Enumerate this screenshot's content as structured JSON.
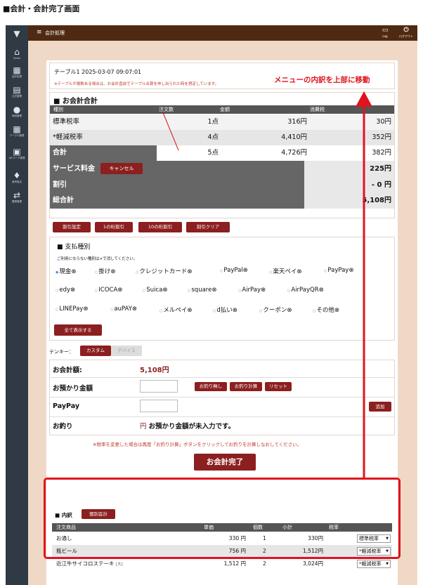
{
  "doc_title": "■会計・会計完了画面",
  "sidebar": {
    "items": [
      {
        "icon": "filter-icon",
        "glyph": "▼",
        "label": ""
      },
      {
        "icon": "home-icon",
        "glyph": "⌂",
        "label": "Home"
      },
      {
        "icon": "calculator-icon",
        "glyph": "▦",
        "label": "会計処理"
      },
      {
        "icon": "document-icon",
        "glyph": "▤",
        "label": "注文管理"
      },
      {
        "icon": "user-icon",
        "glyph": "●",
        "label": "商品管理"
      },
      {
        "icon": "table-icon",
        "glyph": "▦",
        "label": "テーブル管理"
      },
      {
        "icon": "qr-icon",
        "glyph": "▣",
        "label": "QRコード管理"
      },
      {
        "icon": "mic-icon",
        "glyph": "♦",
        "label": "音声設定"
      },
      {
        "icon": "transfer-icon",
        "glyph": "⇄",
        "label": "履歴管理"
      }
    ]
  },
  "topbar": {
    "menu_glyph": "≡",
    "title": "会計処理",
    "log_label": "Log",
    "logout_label": "ログアウト"
  },
  "header": {
    "datetime": "テーブル1 2025-03-07 09:07:01",
    "note": "※テーブルが複数ある場合は、お会計直前でテーブル合算を申し出られた時を想定しています。"
  },
  "summary": {
    "title": "■ お会計合計",
    "columns": [
      "種別",
      "注文数",
      "金額",
      "消費税"
    ],
    "rows": [
      {
        "label": "標準税率",
        "count": "1点",
        "amount": "316円",
        "tax": "30円"
      },
      {
        "label": "*軽減税率",
        "count": "4点",
        "amount": "4,410円",
        "tax": "352円"
      },
      {
        "label": "合計",
        "count": "5点",
        "amount": "4,726円",
        "tax": "382円"
      }
    ],
    "service_label": "サービス料金",
    "cancel_label": "キャンセル",
    "service_value": "225円",
    "discount_label": "割引",
    "discount_value": "- 0 円",
    "total_label": "総合計",
    "total_value": "5,108円"
  },
  "discount_buttons": [
    "割引設定",
    "1の桁割引",
    "10の桁割引",
    "割引クリア"
  ],
  "payment": {
    "title": "■ 支払種別",
    "note": "ご利用にならない種別は×で消してください。",
    "items": [
      "現金⊗",
      "掛け⊗",
      "クレジットカード⊗",
      "PayPal⊗",
      "楽天ペイ⊗",
      "PayPay⊗",
      "edy⊗",
      "ICOCA⊗",
      "Suica⊗",
      "square⊗",
      "AirPay⊗",
      "AirPayQR⊗",
      "LINEPay⊗",
      "auPAY⊗",
      "メルペイ⊗",
      "d払い⊗",
      "クーポン⊗",
      "その他⊗"
    ],
    "show_all": "全て表示する"
  },
  "tenkey": {
    "label": "テンキー：",
    "custom": "カスタム",
    "device": "デバイス"
  },
  "checkout": {
    "total_label": "お会計額:",
    "total_value": "5,108円",
    "deposit_label": "お預かり金額",
    "btn_no_change": "お釣り無し",
    "btn_calc": "お釣り計算",
    "btn_reset": "リセット",
    "paypay_label": "PayPay",
    "add_label": "追加",
    "change_label": "お釣り",
    "change_unit": "円",
    "change_msg": "お預かり金額が未入力です。",
    "warning": "※税率を変更した場合は再度「お釣り計算」ボタンをクリックしてお釣りを計算しなおしてください。",
    "complete": "お会計完了"
  },
  "annotation": "メニューの内訳を上部に移動",
  "breakdown": {
    "title": "■ 内訳",
    "tab": "個別会計",
    "columns": [
      "注文商品",
      "単価",
      "個数",
      "小計",
      "税率"
    ],
    "rows": [
      {
        "name": "お通し",
        "price": "330 円",
        "qty": "1",
        "subtotal": "330円",
        "tax": "標準税率"
      },
      {
        "name": "瓶ビール",
        "price": "756 円",
        "qty": "2",
        "subtotal": "1,512円",
        "tax": "*軽減税率"
      },
      {
        "name": "近江牛サイコロステーキ",
        "size": "[大]",
        "price": "1,512 円",
        "qty": "2",
        "subtotal": "3,024円",
        "tax": "*軽減税率"
      }
    ]
  },
  "colors": {
    "accent": "#8c1f1f",
    "topbar": "#4f2a12",
    "sidebar": "#2f3a45",
    "annotation": "#e0141e"
  }
}
